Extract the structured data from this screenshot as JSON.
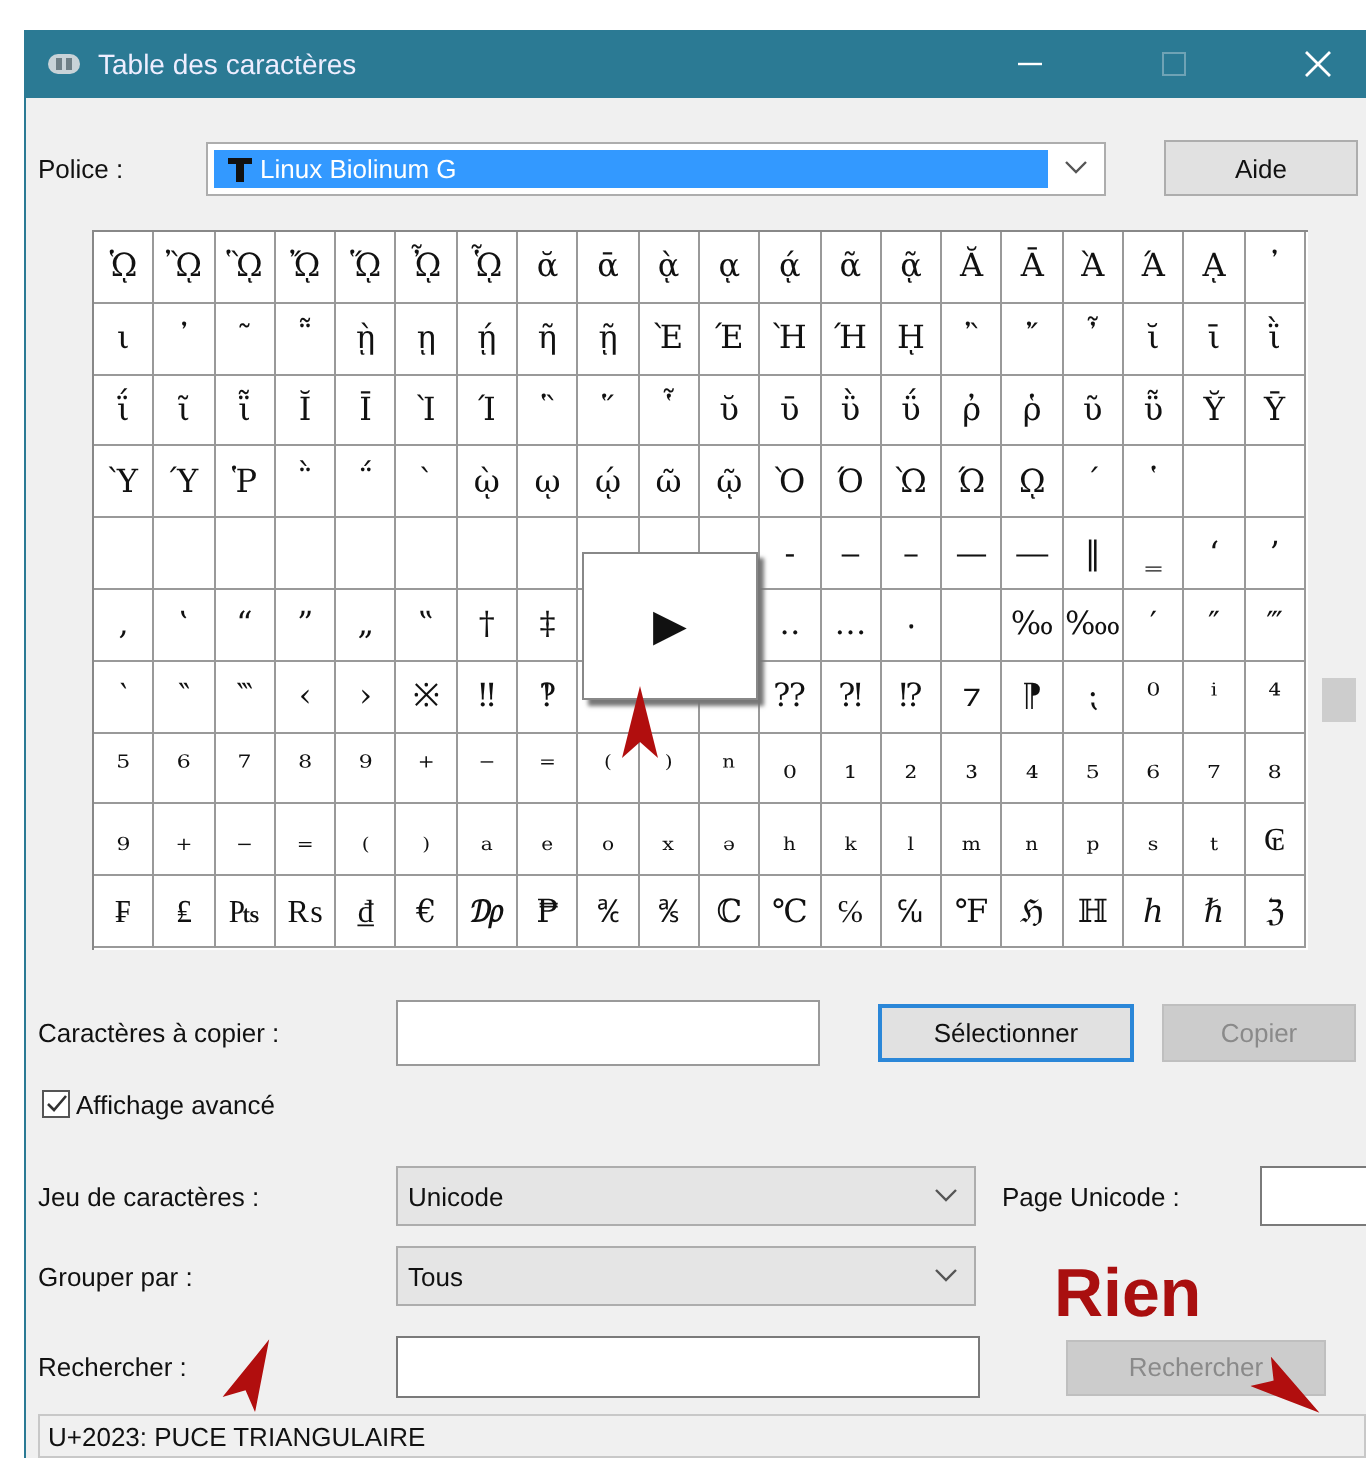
{
  "window": {
    "title": "Table des caractères"
  },
  "font_field": {
    "label": "Police :",
    "value": "Linux Biolinum G"
  },
  "help_button": {
    "label": "Aide"
  },
  "grid": {
    "rows": [
      [
        "ᾩ",
        "ᾪ",
        "ᾫ",
        "ᾬ",
        "ᾭ",
        "ᾮ",
        "ᾯ",
        "ᾰ",
        "ᾱ",
        "ᾲ",
        "ᾳ",
        "ᾴ",
        "ᾶ",
        "ᾷ",
        "Ᾰ",
        "Ᾱ",
        "Ὰ",
        "Ά",
        "ᾼ",
        "᾽"
      ],
      [
        "ι",
        "᾿",
        "῀",
        "῁",
        "ῂ",
        "ῃ",
        "ῄ",
        "ῆ",
        "ῇ",
        "Ὲ",
        "Έ",
        "Ὴ",
        "Ή",
        "ῌ",
        "῍",
        "῎",
        "῏",
        "ῐ",
        "ῑ",
        "ῒ"
      ],
      [
        "ΐ",
        "ῖ",
        "ῗ",
        "Ῐ",
        "Ῑ",
        "Ὶ",
        "Ί",
        "῝",
        "῞",
        "῟",
        "ῠ",
        "ῡ",
        "ῢ",
        "ΰ",
        "ῤ",
        "ῥ",
        "ῦ",
        "ῧ",
        "Ῠ",
        "Ῡ"
      ],
      [
        "Ὺ",
        "Ύ",
        "Ῥ",
        "῭",
        "΅",
        "`",
        "ῲ",
        "ῳ",
        "ῴ",
        "ῶ",
        "ῷ",
        "Ὸ",
        "Ό",
        "Ὼ",
        "Ώ",
        "ῼ",
        "´",
        "῾",
        null,
        null
      ],
      [
        null,
        null,
        null,
        null,
        null,
        null,
        null,
        null,
        null,
        null,
        null,
        "‑",
        "‒",
        "–",
        "—",
        "―",
        "‖",
        "‗",
        "‘",
        "’"
      ],
      [
        "‚",
        "‛",
        "“",
        "”",
        "„",
        "‟",
        "†",
        "‡",
        null,
        null,
        null,
        "‥",
        "…",
        "‧",
        null,
        "‰",
        "‱",
        "′",
        "″",
        "‴"
      ],
      [
        "‵",
        "‶",
        "‷",
        "‹",
        "›",
        "※",
        "‼",
        "‽",
        null,
        null,
        null,
        "⁇",
        "⁈",
        "⁉",
        "⁊",
        "⁋",
        "⁏",
        "⁰",
        "ⁱ",
        "⁴"
      ],
      [
        "⁵",
        "⁶",
        "⁷",
        "⁸",
        "⁹",
        "⁺",
        "⁻",
        "⁼",
        "⁽",
        "⁾",
        "ⁿ",
        "₀",
        "₁",
        "₂",
        "₃",
        "₄",
        "₅",
        "₆",
        "₇",
        "₈"
      ],
      [
        "₉",
        "₊",
        "₋",
        "₌",
        "₍",
        "₎",
        "ₐ",
        "ₑ",
        "ₒ",
        "ₓ",
        "ₔ",
        "ₕ",
        "ₖ",
        "ₗ",
        "ₘ",
        "ₙ",
        "ₚ",
        "ₛ",
        "ₜ",
        "₢"
      ],
      [
        "₣",
        "₤",
        "₧",
        "₨",
        "₫",
        "€",
        "₯",
        "₱",
        "℀",
        "℁",
        "ℂ",
        "℃",
        "℅",
        "℆",
        "℉",
        "ℌ",
        "ℍ",
        "ℎ",
        "ℏ",
        "ℨ"
      ]
    ]
  },
  "magnifier": {
    "char": "▶"
  },
  "copy_field": {
    "label": "Caractères à copier :"
  },
  "select_button": {
    "label": "Sélectionner",
    "disabled": false
  },
  "copy_button": {
    "label": "Copier",
    "disabled": true
  },
  "advanced_view": {
    "label": "Affichage avancé",
    "checked": true
  },
  "charset": {
    "label": "Jeu de caractères :",
    "value": "Unicode"
  },
  "unicode_page": {
    "label": "Page Unicode :"
  },
  "group_by": {
    "label": "Grouper par :",
    "value": "Tous"
  },
  "search": {
    "label": "Rechercher :"
  },
  "search_button": {
    "label": "Rechercher",
    "disabled": true
  },
  "annotation": {
    "text": "Rien"
  },
  "status_bar": {
    "text": "U+2023: PUCE TRIANGULAIRE"
  }
}
